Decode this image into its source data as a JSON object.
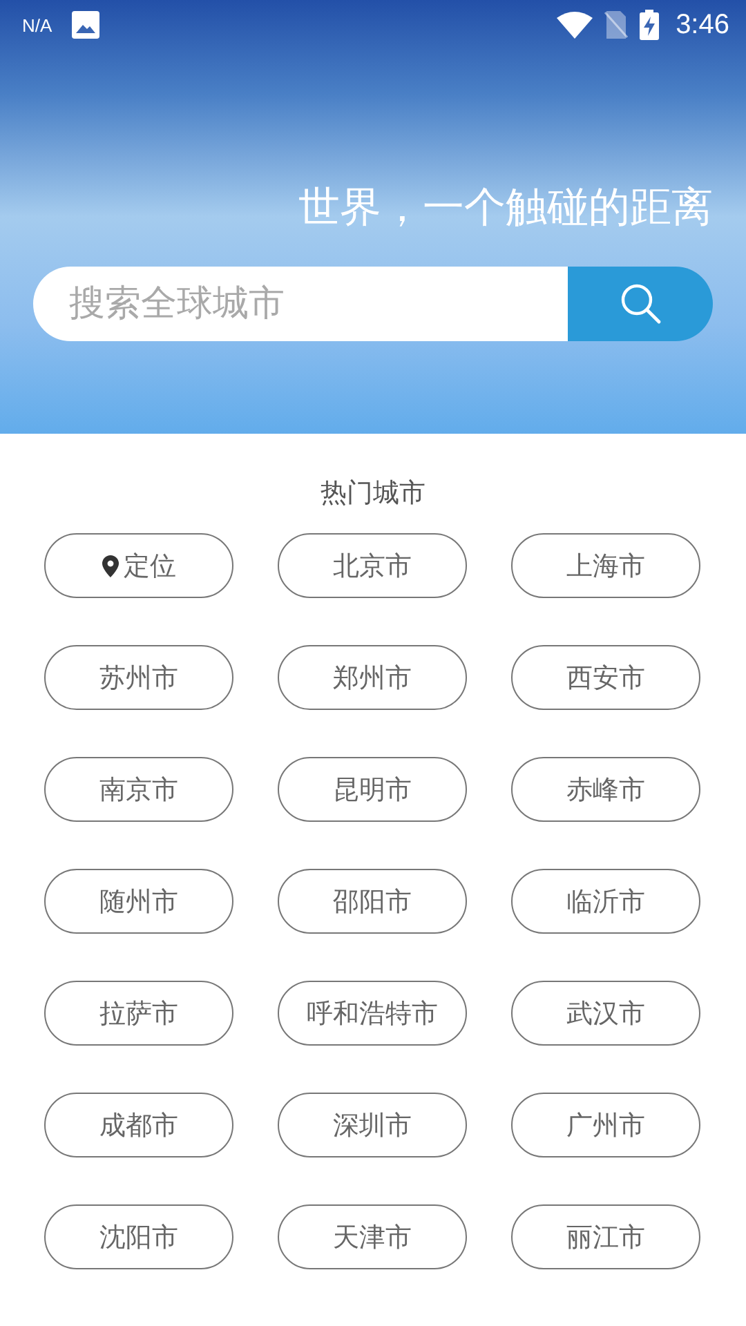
{
  "status_bar": {
    "carrier": "N/A",
    "time": "3:46"
  },
  "header": {
    "slogan": "世界，一个触碰的距离"
  },
  "search": {
    "placeholder": "搜索全球城市"
  },
  "hot_cities": {
    "title": "热门城市",
    "items": [
      {
        "label": "定位",
        "kind": "locate"
      },
      {
        "label": "北京市",
        "kind": "city"
      },
      {
        "label": "上海市",
        "kind": "city"
      },
      {
        "label": "苏州市",
        "kind": "city"
      },
      {
        "label": "郑州市",
        "kind": "city"
      },
      {
        "label": "西安市",
        "kind": "city"
      },
      {
        "label": "南京市",
        "kind": "city"
      },
      {
        "label": "昆明市",
        "kind": "city"
      },
      {
        "label": "赤峰市",
        "kind": "city"
      },
      {
        "label": "随州市",
        "kind": "city"
      },
      {
        "label": "邵阳市",
        "kind": "city"
      },
      {
        "label": "临沂市",
        "kind": "city"
      },
      {
        "label": "拉萨市",
        "kind": "city"
      },
      {
        "label": "呼和浩特市",
        "kind": "city"
      },
      {
        "label": "武汉市",
        "kind": "city"
      },
      {
        "label": "成都市",
        "kind": "city"
      },
      {
        "label": "深圳市",
        "kind": "city"
      },
      {
        "label": "广州市",
        "kind": "city"
      },
      {
        "label": "沈阳市",
        "kind": "city"
      },
      {
        "label": "天津市",
        "kind": "city"
      },
      {
        "label": "丽江市",
        "kind": "city"
      }
    ]
  }
}
